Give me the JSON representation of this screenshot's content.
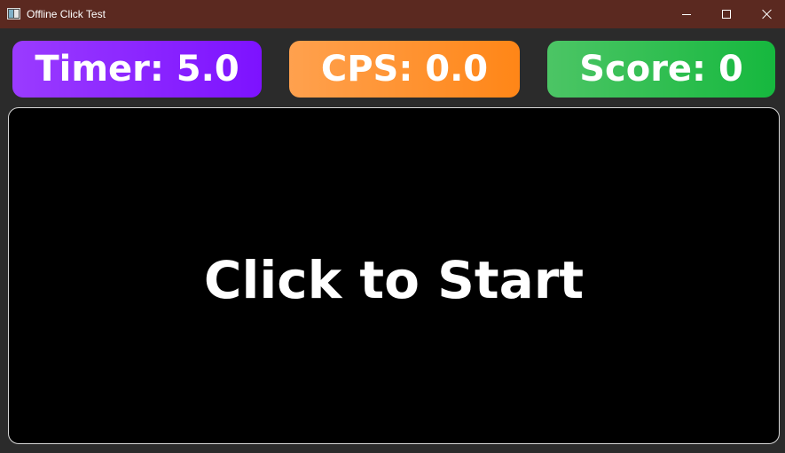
{
  "window": {
    "title": "Offline Click Test",
    "titlebar_color": "#5b2920",
    "background_color": "#2b2b2b"
  },
  "stats": {
    "timer_text": "Timer: 5.0",
    "cps_text": "CPS: 0.0",
    "score_text": "Score: 0",
    "timer_color": "#8a24ff",
    "cps_color": "#ff9430",
    "score_color": "#2fbf50"
  },
  "click_area": {
    "label": "Click to Start",
    "background_color": "#000000"
  },
  "icons": {
    "app": "app-window-icon",
    "minimize": "minimize-icon",
    "maximize": "maximize-icon",
    "close": "close-icon"
  }
}
